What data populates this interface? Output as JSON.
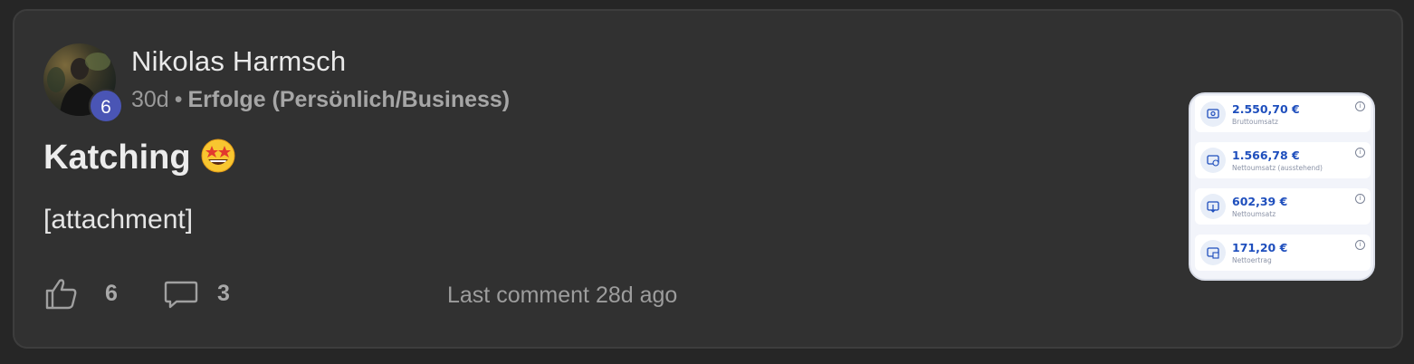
{
  "post": {
    "author": "Nikolas Harmsch",
    "level": "6",
    "age": "30d",
    "separator": "•",
    "category": "Erfolge (Persönlich/Business)",
    "title": "Katching",
    "title_emoji": "star-struck-emoji",
    "body": "[attachment]",
    "likes": "6",
    "comments": "3",
    "last_comment": "Last comment 28d ago"
  },
  "attachment": {
    "stats": [
      {
        "value": "2.550,70 €",
        "label": "Bruttoumsatz",
        "icon": "money-icon"
      },
      {
        "value": "1.566,78 €",
        "label": "Nettoumsatz (ausstehend)",
        "icon": "pending-money-icon"
      },
      {
        "value": "602,39 €",
        "label": "Nettoumsatz",
        "icon": "payout-icon"
      },
      {
        "value": "171,20 €",
        "label": "Nettoertrag",
        "icon": "profit-icon"
      }
    ],
    "info_glyph": "i",
    "accent_color": "#1f4fbd"
  },
  "colors": {
    "card_bg": "#313131",
    "page_bg": "#262626",
    "badge": "#4a55b5"
  }
}
